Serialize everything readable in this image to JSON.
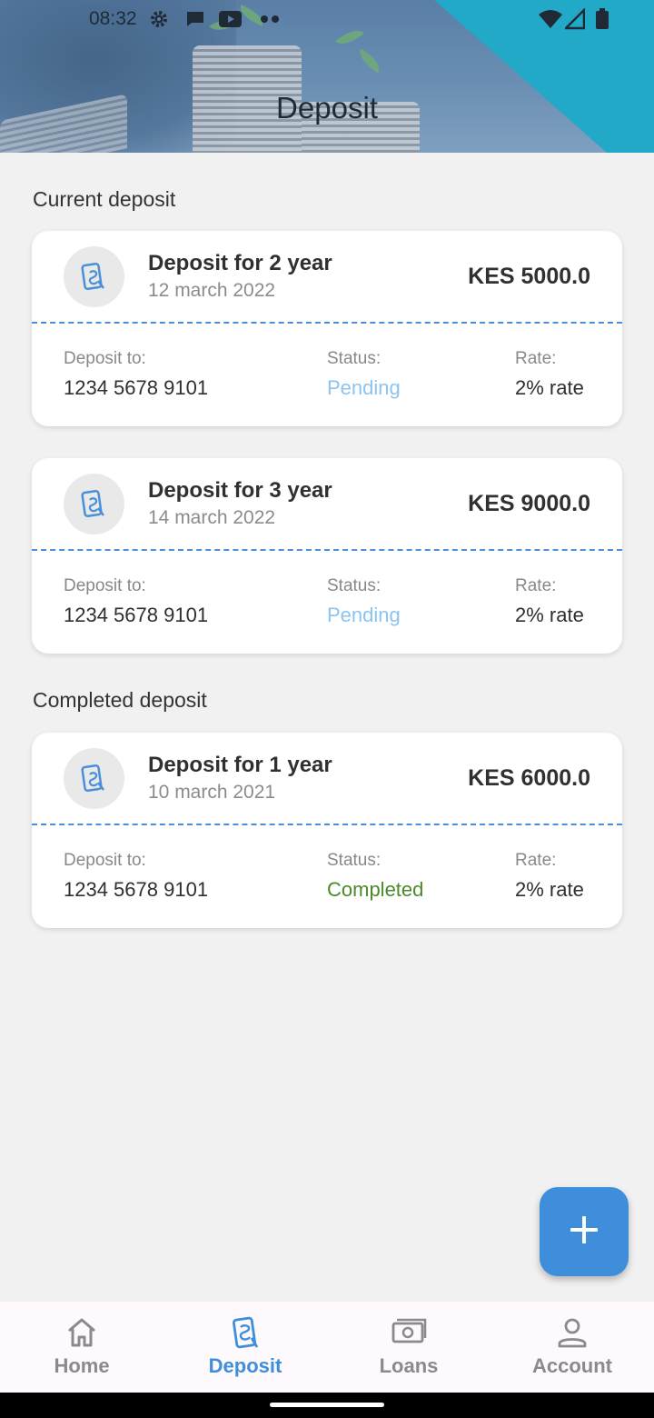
{
  "status_bar": {
    "time": "08:32",
    "left_icons": [
      "gear-icon",
      "chat-icon",
      "youtube-icon",
      "more-dots-icon"
    ],
    "right_icons": [
      "wifi-icon",
      "signal-icon",
      "battery-icon"
    ]
  },
  "header": {
    "title": "Deposit"
  },
  "sections": {
    "current": "Current deposit",
    "completed": "Completed deposit"
  },
  "labels": {
    "deposit_to": "Deposit to:",
    "status": "Status:",
    "rate": "Rate:"
  },
  "deposits": [
    {
      "title": "Deposit for 2 year",
      "date": "12 march 2022",
      "amount": "KES 5000.0",
      "account": "1234 5678 9101",
      "status": "Pending",
      "rate": "2% rate"
    },
    {
      "title": "Deposit for 3 year",
      "date": "14 march 2022",
      "amount": "KES 9000.0",
      "account": "1234 5678 9101",
      "status": "Pending",
      "rate": "2% rate"
    },
    {
      "title": "Deposit for 1 year",
      "date": "10 march 2021",
      "amount": "KES 6000.0",
      "account": "1234 5678 9101",
      "status": "Completed",
      "rate": "2% rate"
    }
  ],
  "fab": {
    "icon": "plus-icon"
  },
  "bottom_nav": {
    "items": [
      {
        "label": "Home",
        "icon": "home-icon"
      },
      {
        "label": "Deposit",
        "icon": "deposit-icon",
        "active": true
      },
      {
        "label": "Loans",
        "icon": "money-icon"
      },
      {
        "label": "Account",
        "icon": "person-icon"
      }
    ]
  },
  "colors": {
    "accent": "#3f8edb",
    "pending": "#8cc3ef",
    "completed": "#4a8a2a",
    "header_teal": "#21a9c7"
  }
}
